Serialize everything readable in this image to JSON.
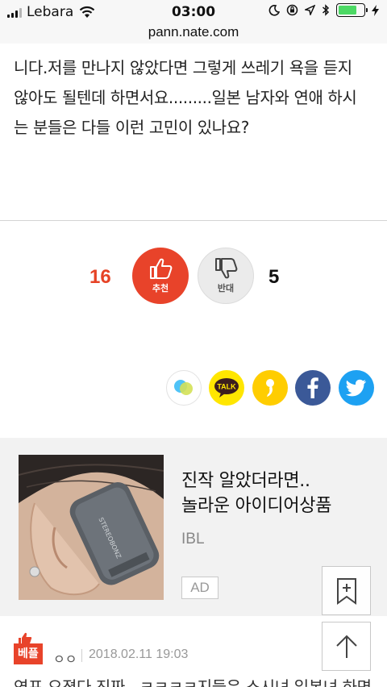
{
  "status_bar": {
    "carrier": "Lebara",
    "time": "03:00",
    "battery_color": "#4cd964"
  },
  "browser": {
    "url": "pann.nate.com"
  },
  "post": {
    "body_lines": [
      "니다.저를 만나지 않았다면 그렇게 쓰레기 욕을 듣지",
      "않아도 될텐데 하면서요.........일본 남자와 연애 하시",
      "는 분들은 다들 이런 고민이 있나요?"
    ]
  },
  "votes": {
    "up_count": "16",
    "up_label": "추천",
    "down_count": "5",
    "down_label": "반대",
    "up_color": "#e8432a"
  },
  "share": {
    "kakao_label": "TALK",
    "icons": [
      "blogs-icon",
      "kakaotalk-icon",
      "kakaostory-icon",
      "facebook-icon",
      "twitter-icon"
    ]
  },
  "ad": {
    "title_line1": "진작 알았더라면..",
    "title_line2": "놀라운 아이디어상품",
    "brand": "IBL",
    "badge": "AD"
  },
  "comment": {
    "badge": "베플",
    "author": "ㅇㅇ",
    "date": "2018.02.11 19:03",
    "text_preview": "연포 오졌다 진짜.. ㅋㅋㅋㅋ지들은 스시녀 일본녀 하면"
  }
}
